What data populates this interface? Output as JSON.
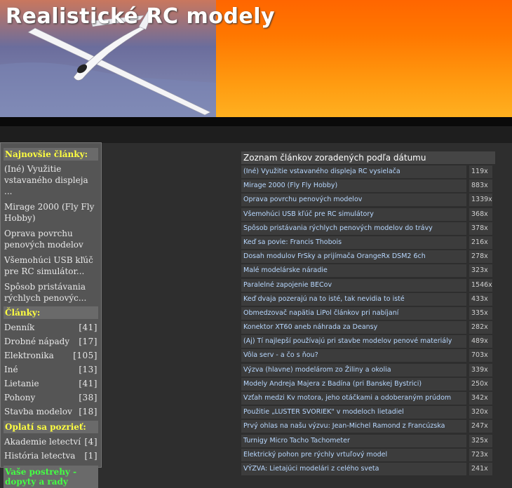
{
  "header": {
    "title": "Realistické RC modely"
  },
  "sidebar": {
    "latest_heading": "Najnovšie články:",
    "latest": [
      "(Iné) Využitie vstavaného displeja ...",
      "Mirage 2000 (Fly Fly Hobby)",
      "Oprava povrchu penových modelov",
      "Všemohúci USB kľúč pre RC simulátor...",
      "Spôsob pristávania rýchlych penovýc..."
    ],
    "categories_heading": "Články:",
    "categories": [
      {
        "name": "Denník",
        "count": "[41]"
      },
      {
        "name": "Drobné nápady",
        "count": "[17]"
      },
      {
        "name": "Elektronika",
        "count": "[105]"
      },
      {
        "name": "Iné",
        "count": "[13]"
      },
      {
        "name": "Lietanie",
        "count": "[41]"
      },
      {
        "name": "Pohony",
        "count": "[38]"
      },
      {
        "name": "Stavba modelov",
        "count": "[18]"
      }
    ],
    "worth_heading": "Oplatí sa pozrieť:",
    "worth": [
      {
        "name": "Akademie letectví",
        "count": "[4]"
      },
      {
        "name": "História letectva",
        "count": "[1]"
      }
    ],
    "comments_heading": "Vaše postrehy - dopyty a rady"
  },
  "articles": {
    "title": "Zoznam článkov zoradených podľa dátumu",
    "rows": [
      {
        "title": "(Iné) Využitie vstavaného displeja RC vysielača",
        "views": "119x"
      },
      {
        "title": "Mirage 2000 (Fly Fly Hobby)",
        "views": "883x"
      },
      {
        "title": "Oprava povrchu penových modelov",
        "views": "1339x"
      },
      {
        "title": "Všemohúci USB kľúč pre RC simulátory",
        "views": "368x"
      },
      {
        "title": "Spôsob pristávania rýchlych penových modelov do trávy",
        "views": "378x"
      },
      {
        "title": "Keď sa povie: Francis Thobois",
        "views": "216x"
      },
      {
        "title": "Dosah modulov FrSky a prijímača OrangeRx DSM2 6ch",
        "views": "278x"
      },
      {
        "title": "Malé modelárske náradie",
        "views": "323x"
      },
      {
        "title": "Paralelné zapojenie BECov",
        "views": "1546x"
      },
      {
        "title": "Keď dvaja pozerajú na to isté, tak nevidia to isté",
        "views": "433x"
      },
      {
        "title": "Obmedzovač napätia LiPol článkov pri nabíjaní",
        "views": "335x"
      },
      {
        "title": "Konektor XT60 aneb náhrada za Deansy",
        "views": "282x"
      },
      {
        "title": "(Aj) Tí najlepší používajú pri stavbe modelov penové materiály",
        "views": "489x"
      },
      {
        "title": "Vôla serv - a čo s ňou?",
        "views": "703x"
      },
      {
        "title": "Výzva (hlavne) modelárom zo Žiliny a okolia",
        "views": "339x"
      },
      {
        "title": "Modely Andreja Majera z Badína (pri Banskej Bystrici)",
        "views": "250x"
      },
      {
        "title": "Vzťah medzi Kv motora, jeho otáčkami a odoberaným prúdom",
        "views": "342x"
      },
      {
        "title": "Použitie „LUSTER SVORIEK\" v modeloch lietadiel",
        "views": "320x"
      },
      {
        "title": "Prvý ohlas na našu výzvu: Jean-Michel Ramond z Francúzska",
        "views": "247x"
      },
      {
        "title": "Turnigy Micro Tacho Tachometer",
        "views": "325x"
      },
      {
        "title": "Elektrický pohon pre rýchly vrtuľový model",
        "views": "723x"
      },
      {
        "title": "VÝZVA: Lietajúci modelári z celého sveta",
        "views": "241x"
      }
    ]
  }
}
